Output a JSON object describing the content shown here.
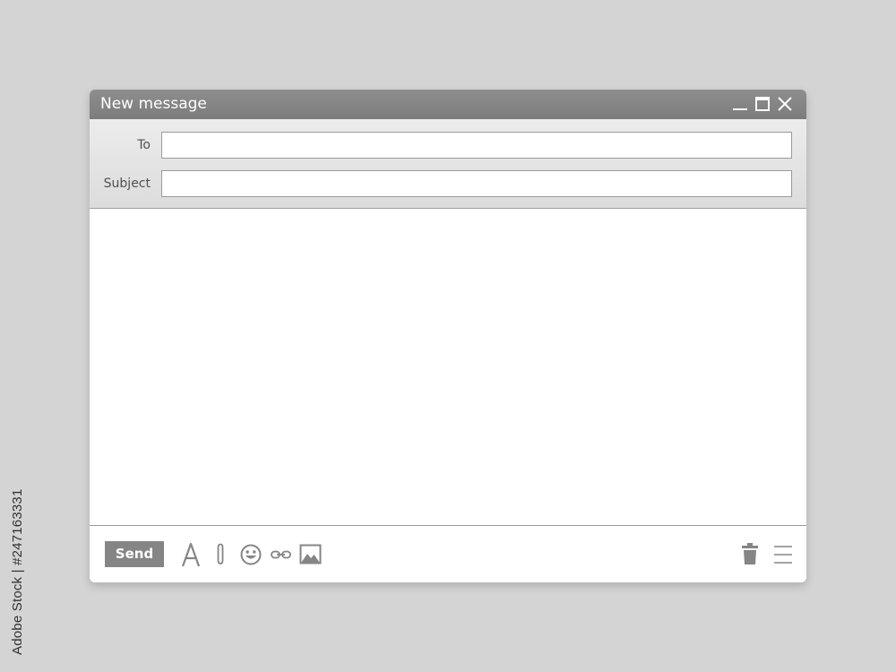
{
  "side_credit": "Adobe Stock | #247163331",
  "window": {
    "title": "New message",
    "controls": [
      "minimize-icon",
      "maximize-icon",
      "close-icon"
    ]
  },
  "fields": {
    "to_label": "To",
    "to_value": "",
    "subject_label": "Subject",
    "subject_value": ""
  },
  "body": {
    "value": ""
  },
  "toolbar": {
    "send_label": "Send",
    "left_tools": [
      "font-format-icon",
      "paperclip-icon",
      "emoji-icon",
      "link-icon",
      "image-icon"
    ],
    "right_tools": [
      "trash-icon",
      "menu-icon"
    ]
  },
  "colors": {
    "background": "#d4d4d4",
    "titlebar": "#858585",
    "header_panel": "#e4e4e4",
    "icon_gray": "#858585",
    "window": "#ffffff"
  }
}
